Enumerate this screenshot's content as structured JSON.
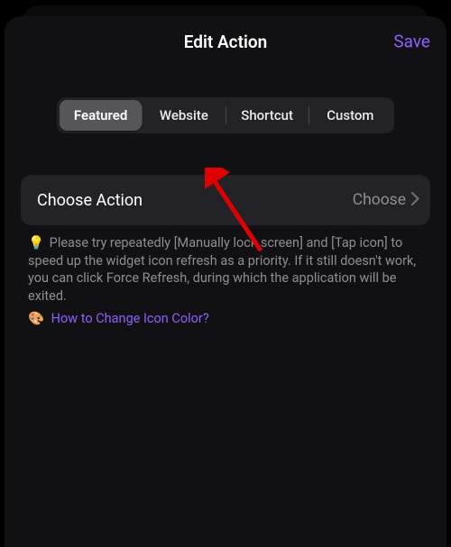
{
  "header": {
    "title": "Edit Action",
    "save": "Save"
  },
  "segmented": {
    "items": [
      "Featured",
      "Website",
      "Shortcut",
      "Custom"
    ],
    "selected_index": 0
  },
  "action_row": {
    "label": "Choose Action",
    "value": "Choose"
  },
  "note": {
    "bulb_icon": "💡",
    "body": "Please try repeatedly [Manually lock screen] and [Tap icon] to speed up the widget icon refresh as a priority. If it still doesn't work, you can click Force Refresh, during which the application will be exited.",
    "palette_icon": "🎨",
    "link_text": "How to Change Icon Color?"
  },
  "annotation": {
    "arrow_color": "#e10000"
  }
}
